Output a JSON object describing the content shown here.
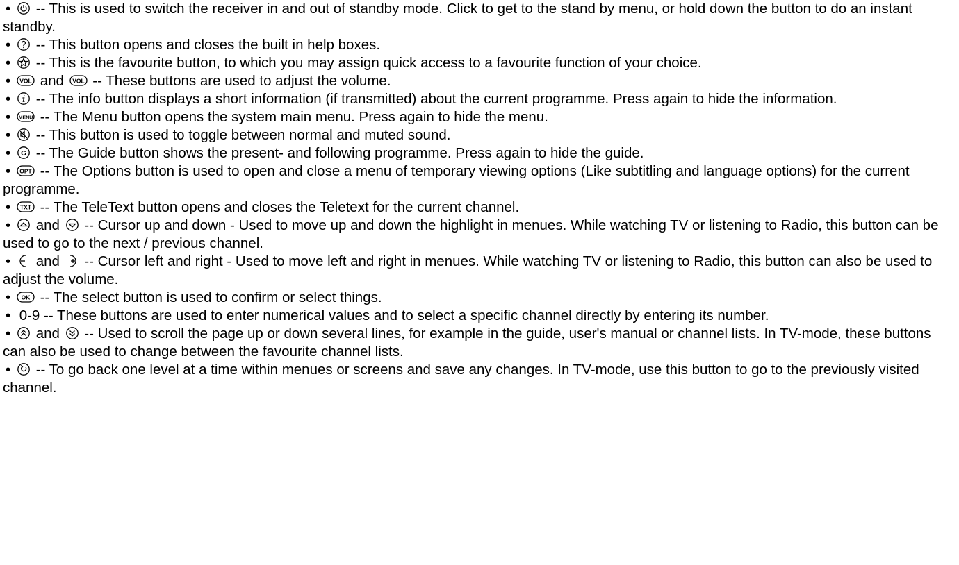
{
  "items": [
    {
      "icons": [
        "power-icon"
      ],
      "text": " -- This is used to switch the receiver in and out of standby mode. Click to get to the stand by menu, or hold down the button to do an instant standby."
    },
    {
      "icons": [
        "help-icon"
      ],
      "text": " -- This button opens and closes the built in help boxes."
    },
    {
      "icons": [
        "favourite-icon"
      ],
      "text": " -- This is the favourite button, to which you may assign quick access to a favourite function of your choice."
    },
    {
      "icons": [
        "volume-up-icon",
        "volume-down-icon"
      ],
      "joiner": " and ",
      "text": " -- These buttons are used to adjust the volume."
    },
    {
      "icons": [
        "info-icon"
      ],
      "text": " -- The info button displays a short information (if transmitted) about the current programme. Press again to hide the information."
    },
    {
      "icons": [
        "menu-icon"
      ],
      "text": " -- The Menu button opens the system main menu. Press again to hide the menu."
    },
    {
      "icons": [
        "mute-icon"
      ],
      "text": " -- This button is used to toggle between normal and muted sound."
    },
    {
      "icons": [
        "guide-icon"
      ],
      "text": " -- The Guide button shows the present- and following programme. Press again to hide the guide."
    },
    {
      "icons": [
        "options-icon"
      ],
      "text": " -- The Options button is used to open and close a menu of temporary viewing options (Like subtitling and language options) for the current programme."
    },
    {
      "icons": [
        "teletext-icon"
      ],
      "text": " -- The TeleText button opens and closes the Teletext for the current channel."
    },
    {
      "icons": [
        "cursor-up-icon",
        "cursor-down-icon"
      ],
      "joiner": " and ",
      "text": " -- Cursor up and down - Used to move up and down the highlight in menues. While watching TV or listening to Radio, this button can be used to go to the next / previous channel."
    },
    {
      "icons": [
        "cursor-left-icon",
        "cursor-right-icon"
      ],
      "joiner": " and ",
      "text": " -- Cursor left and right - Used to move left and right in menues. While watching TV or listening to Radio, this button can also be used to adjust the volume."
    },
    {
      "icons": [
        "ok-icon"
      ],
      "text": " -- The select button is used to confirm or select things."
    },
    {
      "icons": [],
      "text": " 0-9 -- These buttons are used to enter numerical values and to select a specific channel directly by entering its number."
    },
    {
      "icons": [
        "page-up-icon",
        "page-down-icon"
      ],
      "joiner": " and ",
      "text": " -- Used to scroll the page up or down several lines, for example in the guide, user's manual or channel lists. In TV-mode, these buttons can also be used to change between the favourite channel lists."
    },
    {
      "icons": [
        "back-icon"
      ],
      "text": " -- To go back one level at a time within menues or screens and save any changes. In TV-mode, use this button to go to the previously visited channel."
    }
  ],
  "bullet_char": "•",
  "icon_labels": {
    "menu-icon": "MENU",
    "options-icon": "OPT",
    "teletext-icon": "TXT",
    "ok-icon": "OK",
    "guide-icon": "G",
    "volume-up-icon": "VOL",
    "volume-down-icon": "VOL"
  }
}
